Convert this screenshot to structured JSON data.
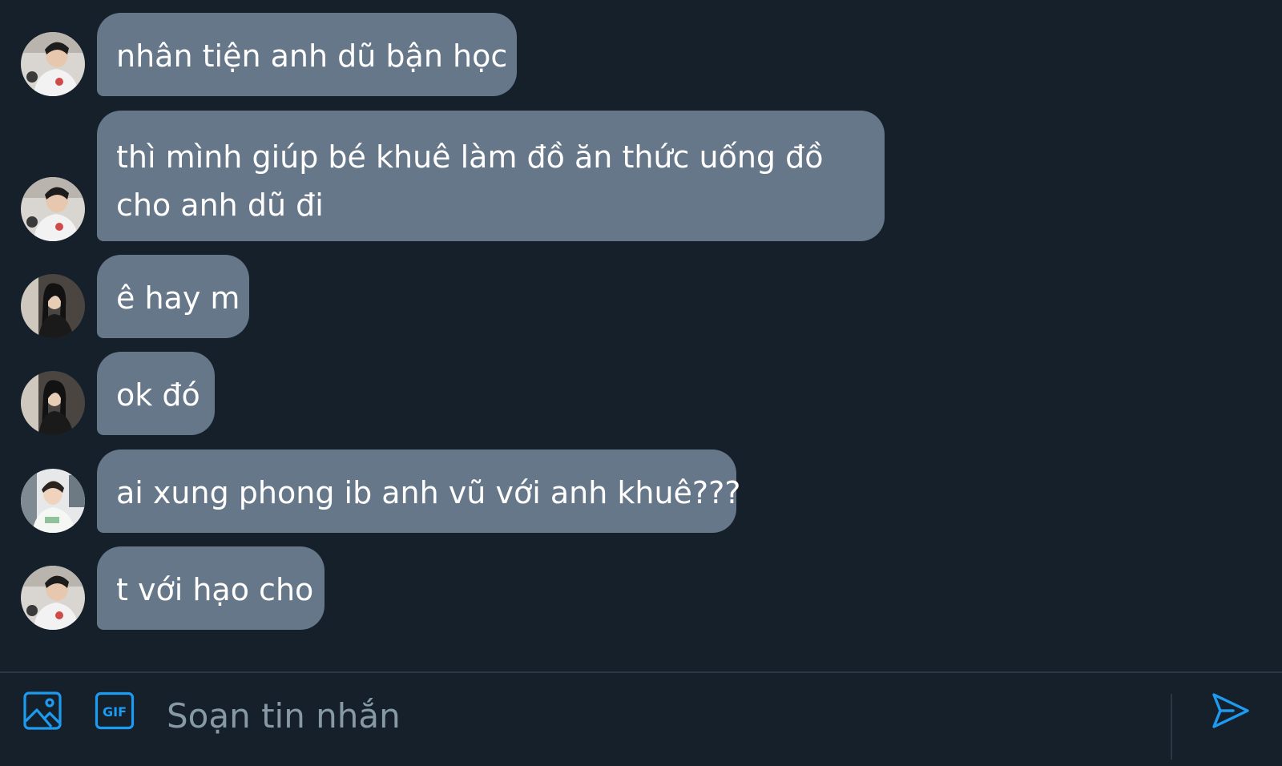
{
  "messages": [
    {
      "text": "nhân tiện anh dũ bận học",
      "avatar": "avatar-a"
    },
    {
      "text": "thì mình giúp bé khuê làm đồ ăn thức uống đồ cho anh dũ đi",
      "avatar": "avatar-a"
    },
    {
      "text": "ê hay m",
      "avatar": "avatar-b"
    },
    {
      "text": "ok đó",
      "avatar": "avatar-b"
    },
    {
      "text": "ai xung phong ib anh vũ với anh khuê???",
      "avatar": "avatar-c"
    },
    {
      "text": "t với hạo cho",
      "avatar": "avatar-a"
    }
  ],
  "composer": {
    "placeholder": "Soạn tin nhắn",
    "value": "",
    "icons": {
      "media": "image-icon",
      "gif": "gif-icon",
      "send": "send-icon"
    },
    "gif_label": "GIF"
  },
  "colors": {
    "background": "#15202b",
    "bubble": "#66778a",
    "accent": "#1d9bf0",
    "placeholder": "#8899a6",
    "divider": "#2b3742"
  }
}
